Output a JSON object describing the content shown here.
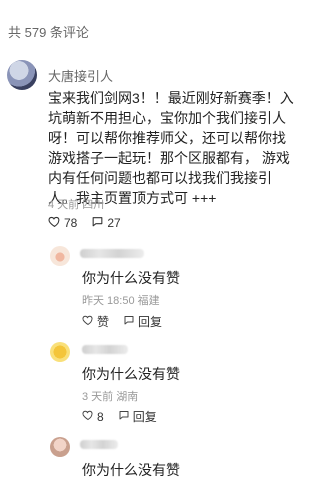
{
  "header": {
    "count_label": "共 579 条评论"
  },
  "main_comment": {
    "username": "大唐接引人",
    "content": "宝来我们剑网3！！最近刚好新赛季！入坑萌新不用担心，宝你加个我们接引人呀！可以帮你推荐师父，还可以帮你找游戏搭子一起玩！那个区服都有， 游戏内有任何问题也都可以找我们我接引人。我主页置顶方式可 +++",
    "meta": "4 天前 四川",
    "likes": "78",
    "replies": "27"
  },
  "replies": [
    {
      "username": "",
      "content": "你为什么没有赞",
      "meta": "昨天 18:50 福建",
      "like_label": "赞",
      "reply_label": "回复"
    },
    {
      "username": "",
      "content": "你为什么没有赞",
      "meta": "3 天前 湖南",
      "like_label": "8",
      "reply_label": "回复"
    },
    {
      "username": "",
      "content": "你为什么没有赞"
    }
  ]
}
